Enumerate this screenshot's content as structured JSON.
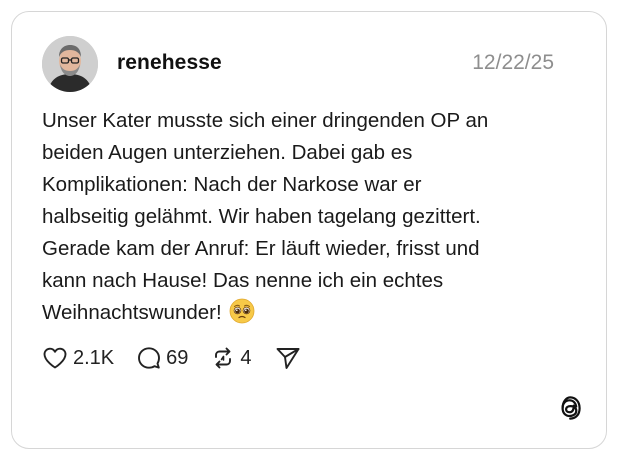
{
  "post": {
    "username": "renehesse",
    "date": "12/22/25",
    "avatar_icon": "user-avatar-photo",
    "text": "Unser Kater musste sich einer dringenden OP an\nbeiden Augen unterziehen. Dabei gab es\nKomplikationen: Nach der Narkose war er\nhalbseitig gelähmt. Wir haben tagelang gezittert.\nGerade kam der Anruf: Er läuft wieder, frisst und\nkann nach Hause! Das nenne ich ein echtes\nWeihnachtswunder!",
    "emoji": "pleading-face-emoji"
  },
  "actions": {
    "likes": "2.1K",
    "comments": "69",
    "reposts": "4",
    "like_icon": "heart-icon",
    "comment_icon": "comment-bubble-icon",
    "repost_icon": "repost-icon",
    "share_icon": "send-icon"
  },
  "brand": {
    "logo_icon": "threads-logo-icon"
  },
  "colors": {
    "text": "#111111",
    "muted": "#8e8e8e",
    "border": "#d6d6d6",
    "emoji": "#f7c948"
  }
}
